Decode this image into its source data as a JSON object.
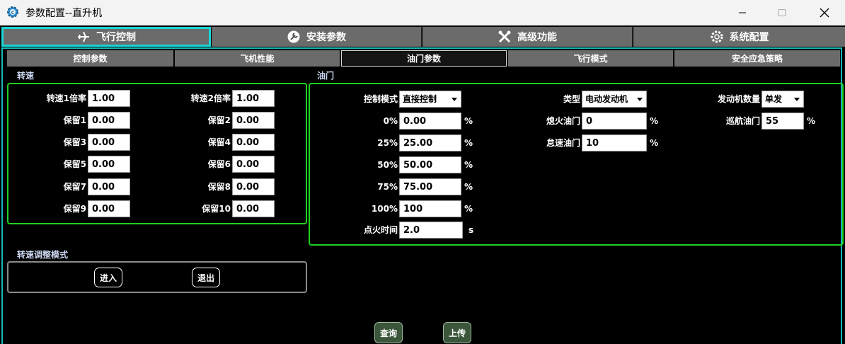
{
  "window": {
    "title": "参数配置--直升机"
  },
  "top_tabs": [
    {
      "label": "飞行控制",
      "icon": "airplane-icon",
      "active": true
    },
    {
      "label": "安装参数",
      "icon": "wrench-circle-icon"
    },
    {
      "label": "高级功能",
      "icon": "tools-icon"
    },
    {
      "label": "系统配置",
      "icon": "gear-icon"
    }
  ],
  "sub_tabs": [
    {
      "label": "控制参数"
    },
    {
      "label": "飞机性能"
    },
    {
      "label": "油门参数",
      "active": true
    },
    {
      "label": "飞行模式"
    },
    {
      "label": "安全应急策略"
    }
  ],
  "rotor_speed": {
    "title": "转速",
    "fields": [
      {
        "label": "转速1倍率",
        "value": "1.00"
      },
      {
        "label": "转速2倍率",
        "value": "1.00"
      },
      {
        "label": "保留1",
        "value": "0.00"
      },
      {
        "label": "保留2",
        "value": "0.00"
      },
      {
        "label": "保留3",
        "value": "0.00"
      },
      {
        "label": "保留4",
        "value": "0.00"
      },
      {
        "label": "保留5",
        "value": "0.00"
      },
      {
        "label": "保留6",
        "value": "0.00"
      },
      {
        "label": "保留7",
        "value": "0.00"
      },
      {
        "label": "保留8",
        "value": "0.00"
      },
      {
        "label": "保留9",
        "value": "0.00"
      },
      {
        "label": "保留10",
        "value": "0.00"
      }
    ]
  },
  "speed_adjust": {
    "title": "转速调整模式",
    "enter_label": "进入",
    "exit_label": "退出"
  },
  "throttle": {
    "title": "油门",
    "control_mode": {
      "label": "控制模式",
      "value": "直接控制"
    },
    "curve": [
      {
        "label": "0%",
        "value": "0.00",
        "unit": "%"
      },
      {
        "label": "25%",
        "value": "25.00",
        "unit": "%"
      },
      {
        "label": "50%",
        "value": "50.00",
        "unit": "%"
      },
      {
        "label": "75%",
        "value": "75.00",
        "unit": "%"
      },
      {
        "label": "100%",
        "value": "100",
        "unit": "%"
      }
    ],
    "ignition_time": {
      "label": "点火时间",
      "value": "2.0",
      "unit": "s"
    },
    "type": {
      "label": "类型",
      "value": "电动发动机"
    },
    "flameout": {
      "label": "熄火油门",
      "value": "0",
      "unit": "%"
    },
    "idle": {
      "label": "怠速油门",
      "value": "10",
      "unit": "%"
    },
    "engine_count": {
      "label": "发动机数量",
      "value": "单发"
    },
    "cruise": {
      "label": "巡航油门",
      "value": "55",
      "unit": "%"
    }
  },
  "actions": {
    "query_label": "查询",
    "upload_label": "上传"
  },
  "colors": {
    "accent_cyan": "#18d6d6",
    "group_green": "#1ed21e",
    "button_green": "#3b563b",
    "tab_gray": "#6b6b6b"
  }
}
